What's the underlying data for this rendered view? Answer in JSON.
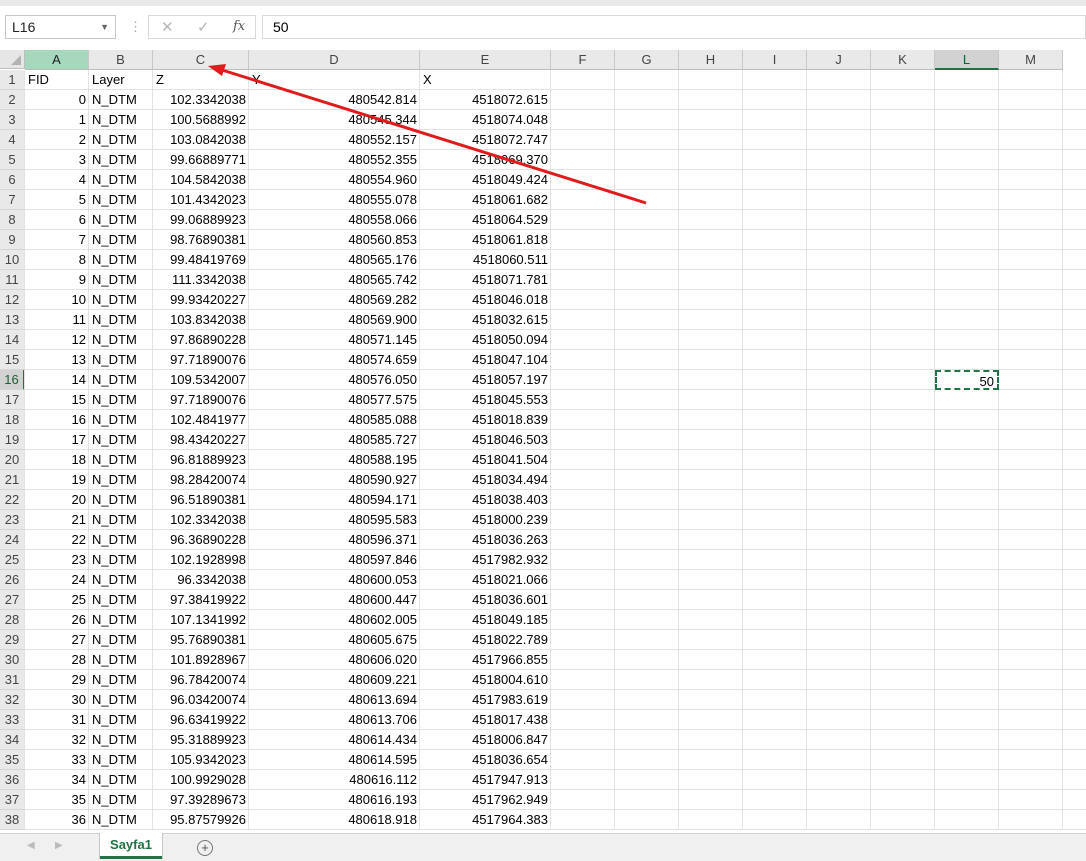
{
  "formula_bar": {
    "name_box": "L16",
    "formula_value": "50",
    "cancel_icon": "✕",
    "enter_icon": "✓",
    "fx_label": "fx"
  },
  "columns": [
    "A",
    "B",
    "C",
    "D",
    "E",
    "F",
    "G",
    "H",
    "I",
    "J",
    "K",
    "L",
    "M"
  ],
  "selected_column": "L",
  "selected_row": 16,
  "header_row": [
    "FID",
    "Layer",
    "Z",
    "Y",
    "X"
  ],
  "rows": [
    {
      "fid": "0",
      "layer": "N_DTM",
      "z": "102.3342038",
      "y": "480542.814",
      "x": "4518072.615"
    },
    {
      "fid": "1",
      "layer": "N_DTM",
      "z": "100.5688992",
      "y": "480545.344",
      "x": "4518074.048"
    },
    {
      "fid": "2",
      "layer": "N_DTM",
      "z": "103.0842038",
      "y": "480552.157",
      "x": "4518072.747"
    },
    {
      "fid": "3",
      "layer": "N_DTM",
      "z": "99.66889771",
      "y": "480552.355",
      "x": "4518069.370"
    },
    {
      "fid": "4",
      "layer": "N_DTM",
      "z": "104.5842038",
      "y": "480554.960",
      "x": "4518049.424"
    },
    {
      "fid": "5",
      "layer": "N_DTM",
      "z": "101.4342023",
      "y": "480555.078",
      "x": "4518061.682"
    },
    {
      "fid": "6",
      "layer": "N_DTM",
      "z": "99.06889923",
      "y": "480558.066",
      "x": "4518064.529"
    },
    {
      "fid": "7",
      "layer": "N_DTM",
      "z": "98.76890381",
      "y": "480560.853",
      "x": "4518061.818"
    },
    {
      "fid": "8",
      "layer": "N_DTM",
      "z": "99.48419769",
      "y": "480565.176",
      "x": "4518060.511"
    },
    {
      "fid": "9",
      "layer": "N_DTM",
      "z": "111.3342038",
      "y": "480565.742",
      "x": "4518071.781"
    },
    {
      "fid": "10",
      "layer": "N_DTM",
      "z": "99.93420227",
      "y": "480569.282",
      "x": "4518046.018"
    },
    {
      "fid": "11",
      "layer": "N_DTM",
      "z": "103.8342038",
      "y": "480569.900",
      "x": "4518032.615"
    },
    {
      "fid": "12",
      "layer": "N_DTM",
      "z": "97.86890228",
      "y": "480571.145",
      "x": "4518050.094"
    },
    {
      "fid": "13",
      "layer": "N_DTM",
      "z": "97.71890076",
      "y": "480574.659",
      "x": "4518047.104"
    },
    {
      "fid": "14",
      "layer": "N_DTM",
      "z": "109.5342007",
      "y": "480576.050",
      "x": "4518057.197"
    },
    {
      "fid": "15",
      "layer": "N_DTM",
      "z": "97.71890076",
      "y": "480577.575",
      "x": "4518045.553"
    },
    {
      "fid": "16",
      "layer": "N_DTM",
      "z": "102.4841977",
      "y": "480585.088",
      "x": "4518018.839"
    },
    {
      "fid": "17",
      "layer": "N_DTM",
      "z": "98.43420227",
      "y": "480585.727",
      "x": "4518046.503"
    },
    {
      "fid": "18",
      "layer": "N_DTM",
      "z": "96.81889923",
      "y": "480588.195",
      "x": "4518041.504"
    },
    {
      "fid": "19",
      "layer": "N_DTM",
      "z": "98.28420074",
      "y": "480590.927",
      "x": "4518034.494"
    },
    {
      "fid": "20",
      "layer": "N_DTM",
      "z": "96.51890381",
      "y": "480594.171",
      "x": "4518038.403"
    },
    {
      "fid": "21",
      "layer": "N_DTM",
      "z": "102.3342038",
      "y": "480595.583",
      "x": "4518000.239"
    },
    {
      "fid": "22",
      "layer": "N_DTM",
      "z": "96.36890228",
      "y": "480596.371",
      "x": "4518036.263"
    },
    {
      "fid": "23",
      "layer": "N_DTM",
      "z": "102.1928998",
      "y": "480597.846",
      "x": "4517982.932"
    },
    {
      "fid": "24",
      "layer": "N_DTM",
      "z": "96.3342038",
      "y": "480600.053",
      "x": "4518021.066"
    },
    {
      "fid": "25",
      "layer": "N_DTM",
      "z": "97.38419922",
      "y": "480600.447",
      "x": "4518036.601"
    },
    {
      "fid": "26",
      "layer": "N_DTM",
      "z": "107.1341992",
      "y": "480602.005",
      "x": "4518049.185"
    },
    {
      "fid": "27",
      "layer": "N_DTM",
      "z": "95.76890381",
      "y": "480605.675",
      "x": "4518022.789"
    },
    {
      "fid": "28",
      "layer": "N_DTM",
      "z": "101.8928967",
      "y": "480606.020",
      "x": "4517966.855"
    },
    {
      "fid": "29",
      "layer": "N_DTM",
      "z": "96.78420074",
      "y": "480609.221",
      "x": "4518004.610"
    },
    {
      "fid": "30",
      "layer": "N_DTM",
      "z": "96.03420074",
      "y": "480613.694",
      "x": "4517983.619"
    },
    {
      "fid": "31",
      "layer": "N_DTM",
      "z": "96.63419922",
      "y": "480613.706",
      "x": "4518017.438"
    },
    {
      "fid": "32",
      "layer": "N_DTM",
      "z": "95.31889923",
      "y": "480614.434",
      "x": "4518006.847"
    },
    {
      "fid": "33",
      "layer": "N_DTM",
      "z": "105.9342023",
      "y": "480614.595",
      "x": "4518036.654"
    },
    {
      "fid": "34",
      "layer": "N_DTM",
      "z": "100.9929028",
      "y": "480616.112",
      "x": "4517947.913"
    },
    {
      "fid": "35",
      "layer": "N_DTM",
      "z": "97.39289673",
      "y": "480616.193",
      "x": "4517962.949"
    },
    {
      "fid": "36",
      "layer": "N_DTM",
      "z": "95.87579926",
      "y": "480618.918",
      "x": "4517964.383"
    }
  ],
  "active_cell": {
    "ref": "L16",
    "value": "50"
  },
  "sheet_tab": "Sayfa1",
  "add_sheet_icon": "+",
  "annotation": {
    "color": "#e01b1b"
  },
  "colors": {
    "accent": "#217346",
    "grid": "#e2e2e2",
    "header_bg": "#e9e9e9"
  }
}
